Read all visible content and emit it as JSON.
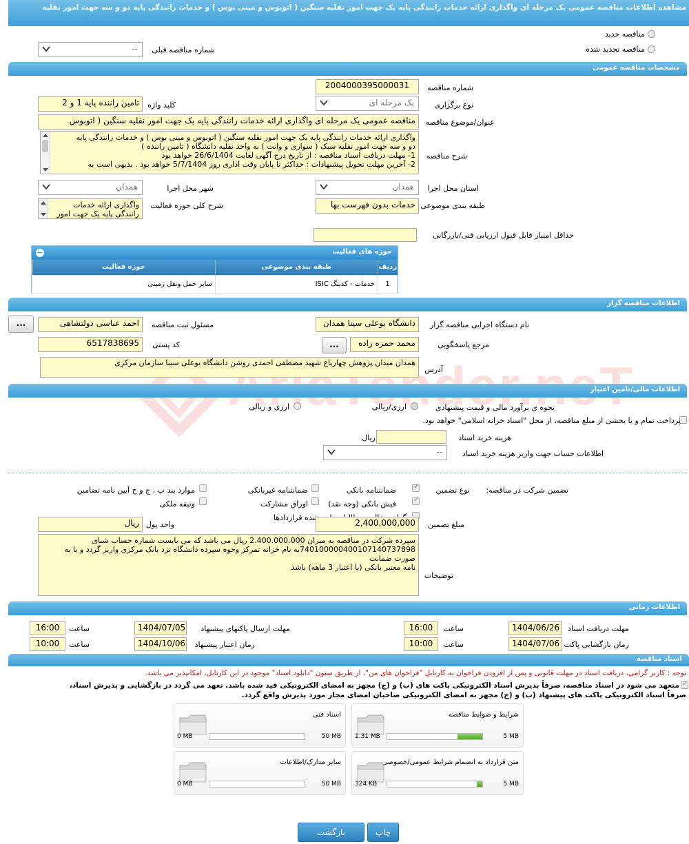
{
  "page_title": "مشاهده اطلاعات مناقصه عمومی یک مرحله ای واگذاری ارائه خدمات رانندگی پایه یک جهت امور نقلیه سنگین ( اتوبوس و مینی بوس ) و خدمات رانندگی پایه دو و سه جهت امور نقلیه",
  "watermark": "AriaTender.neT",
  "top": {
    "radio_new": "مناقصه جدید",
    "radio_renew": "مناقصه تجدید شده",
    "prev_label": "شماره مناقصه قبلی",
    "prev_value": "--"
  },
  "general": {
    "header": "مشخصات مناقصه عمومی",
    "number_label": "شماره مناقصه",
    "number_value": "2004000395000031",
    "type_label": "نوع برگزاری",
    "type_value": "یک مرحله ای",
    "keyword_label": "کلید واژه",
    "keyword_value": "تامین راننده پایه 1 و 2",
    "subject_label": "عنوان/موضوع مناقصه",
    "subject_value": "مناقصه عمومی یک مرحله ای واگذاری ارائه خدمات رانندگی پایه یک جهت امور نقلیه سنگین ( اتوبوس",
    "desc_label": "شرح مناقصه",
    "desc_lines": [
      "واگذاری ارائه خدمات رانندگی پایه یک جهت امور نقلیه سنگین ( اتوبوس و مینی بوس ) و خدمات رانندگی پایه",
      "دو و سه جهت امور نقلیه سبک ( سواری و وانت ) به واحد نقلیه دانشگاه ( تامین راننده )",
      "1-    مهلت دریافت اسناد مناقصه : از تاریخ درج آگهی لغایت 26/6/1404 خواهد بود",
      "2-    آخرین مهلت تحویل پیشنهادات : حداکثر تا پایان وقت اداری روز 5/7/1404 خواهد بود . بدیهی است به"
    ],
    "province_label": "استان محل اجرا",
    "province_value": "همدان",
    "city_label": "شهر محل اجرا",
    "city_value": "همدان",
    "category_label": "طبقه بندی موضوعی",
    "category_value": "خدمات بدون فهرست بها",
    "activity_desc_label": "شرح کلی حوزه فعالیت",
    "activity_desc_lines": [
      "واگذاری ارائه خدمات",
      "رانندگی پایه یک جهت امور"
    ],
    "min_score_label": "حداقل امتیاز قابل قبول ارزیابی فنی/بازرگانی",
    "min_score_value": ""
  },
  "activity_table": {
    "title": "حوزه های فعالیت",
    "headers": [
      "ردیف",
      "طبقه بندی موضوعی",
      "حوزه فعالیت"
    ],
    "rows": [
      [
        "1",
        "خدمات - کدینگ ISIC",
        "سایر حمل ونقل زمینی"
      ]
    ]
  },
  "organizer": {
    "header": "اطلاعات مناقصه گزار",
    "org_label": "نام دستگاه اجرایی مناقصه گزار",
    "org_value": "دانشگاه بوعلی سینا همدان",
    "reg_label": "مسئول ثبت مناقصه",
    "reg_value": "احمد عباسی دولتشاهی",
    "ref_label": "مرجع پاسخگویی",
    "ref_value": "محمد حمزه زاده",
    "postal_label": "کد پستی",
    "postal_value": "6517838695",
    "address_label": "آدرس",
    "address_value": "همدان میدان پژوهش چهارباغ شهید مصطفی احمدی روشن دانشگاه بوعلی سینا سازمان مرکزی",
    "dots_button": "..."
  },
  "finance": {
    "header": "اطلاعات مالی/تامین اعتبار",
    "estimate_label": "نحوه ی برآورد مالی و قیمت پیشنهادی",
    "opt_currency": "ارزی/ریالی",
    "opt_rial": "ارزی و ریالی",
    "treasury_text": "پرداخت تمام و یا بخشی از مبلغ مناقصه، از محل \"اسناد خزانه اسلامی\" خواهد بود.",
    "doc_cost_label": "هزینه خرید اسناد",
    "doc_cost_unit": "ریال",
    "doc_cost_value": "",
    "account_label": "اطلاعات حساب جهت واریز هزینه خرید اسناد",
    "account_value": "--"
  },
  "guarantee": {
    "label": "تضمین شرکت در مناقصه:",
    "type_label": "نوع تضمین",
    "options": {
      "bank": "ضمانتنامه بانکی",
      "nonbank": "ضمانتنامه غیربانکی",
      "clauses": "موارد بند پ ، ج و خ آیین نامه تضامین",
      "receipt": "فیش بانکی (وجه نقد)",
      "bonds": "اوراق مشارکت",
      "property": "وثیقه ملکی",
      "certificate": "گواهی خالص مطالبات تایید شده قراردادها"
    },
    "amount_label": "مبلغ تضمین",
    "amount_value": "2,400,000,000",
    "currency_label": "واحد پول",
    "currency_value": "ریال",
    "notes_label": "توضیحات",
    "notes_lines": [
      "سپرده شرکت در مناقصه به میزان  2.400.000.000 ریال می باشد که می بایست شماره حساب شبای",
      "740100000400107140737898به نام خزانه تمرکز وجوه سپرده دانشگاه نزد بانک مرکزی واریز گردد و یا به صورت ضمانت",
      "نامه معتبر بانکی (با اعتبار 3 ماهه) باشد"
    ]
  },
  "timing": {
    "header": "اطلاعات زمانی",
    "receive_label": "مهلت دریافت اسناد",
    "receive_date": "1404/06/26",
    "time_label": "ساعت",
    "receive_time": "16:00",
    "send_label": "مهلت ارسال پاکتهای پیشنهاد",
    "send_date": "1404/07/05",
    "send_time": "16:00",
    "open_label": "زمان بازگشایی پاکت ها",
    "open_date": "1404/07/06",
    "open_time": "10:00",
    "valid_label": "زمان اعتبار پیشنهاد",
    "valid_date": "1404/10/06",
    "valid_time": "10:00"
  },
  "documents": {
    "header": "اسناد مناقصه",
    "notice": "توجه : کاربر گرامی، دریافت اسناد در مهلت قانونی و پس از افزودن فراخوان به کارتابل \"فراخوان های من\"، از طریق ستون \"دانلود اسناد\" موجود در این کارتابل، امکانپذیر می باشد.",
    "commit_line1": "متعهد می شود در اسناد مناقصه، صرفاً پذیرش اسناد الکترونیکی پاکت های (ب) و (ج) مجهز به امضای الکترونیکی قید شده باشد. تعهد می گردد در بازگشایی و پذیرش اسناد،",
    "commit_line2": "صرفاً اسناد الکترونیکی پاکت های پیشنهاد (ب) و (ج) مجهز به امضای الکترونیکی صاحبان امضای مجاز مورد پذیرش واقع گردد.",
    "cards": [
      {
        "title": "شرایط و ضوابط مناقصه",
        "used": "1.31 MB",
        "max": "5 MB",
        "fraction": 0.26
      },
      {
        "title": "اسناد فنی",
        "used": "0 MB",
        "max": "50 MB",
        "fraction": 0
      },
      {
        "title": "متن قرارداد به انضمام شرایط عمومی/خصوصی",
        "used": "324 KB",
        "max": "5 MB",
        "fraction": 0.06
      },
      {
        "title": "سایر مدارک/اطلاعات",
        "used": "0 MB",
        "max": "50 MB",
        "fraction": 0
      }
    ]
  },
  "footer": {
    "print": "چاپ",
    "back": "بازگشت"
  },
  "colors": {
    "header_blue": "#3a9fd8",
    "field_yellow": "#fefbc8",
    "notice_red": "#dd1111",
    "bar_green": "#5fb83a"
  }
}
